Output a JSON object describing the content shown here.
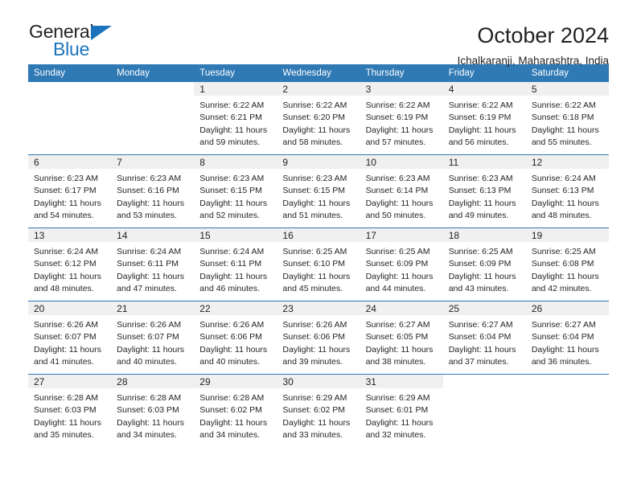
{
  "brand": {
    "name_top": "General",
    "name_bottom": "Blue",
    "accent_color": "#1b74bb"
  },
  "header": {
    "title": "October 2024",
    "subtitle": "Ichalkaranji, Maharashtra, India"
  },
  "calendar": {
    "header_color": "#2f79b5",
    "daynum_bg": "#f0f0f0",
    "weekday_labels": [
      "Sunday",
      "Monday",
      "Tuesday",
      "Wednesday",
      "Thursday",
      "Friday",
      "Saturday"
    ],
    "weeks": [
      [
        {
          "day": "",
          "blank": true
        },
        {
          "day": "",
          "blank": true
        },
        {
          "day": "1",
          "sunrise": "Sunrise: 6:22 AM",
          "sunset": "Sunset: 6:21 PM",
          "daylight1": "Daylight: 11 hours",
          "daylight2": "and 59 minutes."
        },
        {
          "day": "2",
          "sunrise": "Sunrise: 6:22 AM",
          "sunset": "Sunset: 6:20 PM",
          "daylight1": "Daylight: 11 hours",
          "daylight2": "and 58 minutes."
        },
        {
          "day": "3",
          "sunrise": "Sunrise: 6:22 AM",
          "sunset": "Sunset: 6:19 PM",
          "daylight1": "Daylight: 11 hours",
          "daylight2": "and 57 minutes."
        },
        {
          "day": "4",
          "sunrise": "Sunrise: 6:22 AM",
          "sunset": "Sunset: 6:19 PM",
          "daylight1": "Daylight: 11 hours",
          "daylight2": "and 56 minutes."
        },
        {
          "day": "5",
          "sunrise": "Sunrise: 6:22 AM",
          "sunset": "Sunset: 6:18 PM",
          "daylight1": "Daylight: 11 hours",
          "daylight2": "and 55 minutes."
        }
      ],
      [
        {
          "day": "6",
          "sunrise": "Sunrise: 6:23 AM",
          "sunset": "Sunset: 6:17 PM",
          "daylight1": "Daylight: 11 hours",
          "daylight2": "and 54 minutes."
        },
        {
          "day": "7",
          "sunrise": "Sunrise: 6:23 AM",
          "sunset": "Sunset: 6:16 PM",
          "daylight1": "Daylight: 11 hours",
          "daylight2": "and 53 minutes."
        },
        {
          "day": "8",
          "sunrise": "Sunrise: 6:23 AM",
          "sunset": "Sunset: 6:15 PM",
          "daylight1": "Daylight: 11 hours",
          "daylight2": "and 52 minutes."
        },
        {
          "day": "9",
          "sunrise": "Sunrise: 6:23 AM",
          "sunset": "Sunset: 6:15 PM",
          "daylight1": "Daylight: 11 hours",
          "daylight2": "and 51 minutes."
        },
        {
          "day": "10",
          "sunrise": "Sunrise: 6:23 AM",
          "sunset": "Sunset: 6:14 PM",
          "daylight1": "Daylight: 11 hours",
          "daylight2": "and 50 minutes."
        },
        {
          "day": "11",
          "sunrise": "Sunrise: 6:23 AM",
          "sunset": "Sunset: 6:13 PM",
          "daylight1": "Daylight: 11 hours",
          "daylight2": "and 49 minutes."
        },
        {
          "day": "12",
          "sunrise": "Sunrise: 6:24 AM",
          "sunset": "Sunset: 6:13 PM",
          "daylight1": "Daylight: 11 hours",
          "daylight2": "and 48 minutes."
        }
      ],
      [
        {
          "day": "13",
          "sunrise": "Sunrise: 6:24 AM",
          "sunset": "Sunset: 6:12 PM",
          "daylight1": "Daylight: 11 hours",
          "daylight2": "and 48 minutes."
        },
        {
          "day": "14",
          "sunrise": "Sunrise: 6:24 AM",
          "sunset": "Sunset: 6:11 PM",
          "daylight1": "Daylight: 11 hours",
          "daylight2": "and 47 minutes."
        },
        {
          "day": "15",
          "sunrise": "Sunrise: 6:24 AM",
          "sunset": "Sunset: 6:11 PM",
          "daylight1": "Daylight: 11 hours",
          "daylight2": "and 46 minutes."
        },
        {
          "day": "16",
          "sunrise": "Sunrise: 6:25 AM",
          "sunset": "Sunset: 6:10 PM",
          "daylight1": "Daylight: 11 hours",
          "daylight2": "and 45 minutes."
        },
        {
          "day": "17",
          "sunrise": "Sunrise: 6:25 AM",
          "sunset": "Sunset: 6:09 PM",
          "daylight1": "Daylight: 11 hours",
          "daylight2": "and 44 minutes."
        },
        {
          "day": "18",
          "sunrise": "Sunrise: 6:25 AM",
          "sunset": "Sunset: 6:09 PM",
          "daylight1": "Daylight: 11 hours",
          "daylight2": "and 43 minutes."
        },
        {
          "day": "19",
          "sunrise": "Sunrise: 6:25 AM",
          "sunset": "Sunset: 6:08 PM",
          "daylight1": "Daylight: 11 hours",
          "daylight2": "and 42 minutes."
        }
      ],
      [
        {
          "day": "20",
          "sunrise": "Sunrise: 6:26 AM",
          "sunset": "Sunset: 6:07 PM",
          "daylight1": "Daylight: 11 hours",
          "daylight2": "and 41 minutes."
        },
        {
          "day": "21",
          "sunrise": "Sunrise: 6:26 AM",
          "sunset": "Sunset: 6:07 PM",
          "daylight1": "Daylight: 11 hours",
          "daylight2": "and 40 minutes."
        },
        {
          "day": "22",
          "sunrise": "Sunrise: 6:26 AM",
          "sunset": "Sunset: 6:06 PM",
          "daylight1": "Daylight: 11 hours",
          "daylight2": "and 40 minutes."
        },
        {
          "day": "23",
          "sunrise": "Sunrise: 6:26 AM",
          "sunset": "Sunset: 6:06 PM",
          "daylight1": "Daylight: 11 hours",
          "daylight2": "and 39 minutes."
        },
        {
          "day": "24",
          "sunrise": "Sunrise: 6:27 AM",
          "sunset": "Sunset: 6:05 PM",
          "daylight1": "Daylight: 11 hours",
          "daylight2": "and 38 minutes."
        },
        {
          "day": "25",
          "sunrise": "Sunrise: 6:27 AM",
          "sunset": "Sunset: 6:04 PM",
          "daylight1": "Daylight: 11 hours",
          "daylight2": "and 37 minutes."
        },
        {
          "day": "26",
          "sunrise": "Sunrise: 6:27 AM",
          "sunset": "Sunset: 6:04 PM",
          "daylight1": "Daylight: 11 hours",
          "daylight2": "and 36 minutes."
        }
      ],
      [
        {
          "day": "27",
          "sunrise": "Sunrise: 6:28 AM",
          "sunset": "Sunset: 6:03 PM",
          "daylight1": "Daylight: 11 hours",
          "daylight2": "and 35 minutes."
        },
        {
          "day": "28",
          "sunrise": "Sunrise: 6:28 AM",
          "sunset": "Sunset: 6:03 PM",
          "daylight1": "Daylight: 11 hours",
          "daylight2": "and 34 minutes."
        },
        {
          "day": "29",
          "sunrise": "Sunrise: 6:28 AM",
          "sunset": "Sunset: 6:02 PM",
          "daylight1": "Daylight: 11 hours",
          "daylight2": "and 34 minutes."
        },
        {
          "day": "30",
          "sunrise": "Sunrise: 6:29 AM",
          "sunset": "Sunset: 6:02 PM",
          "daylight1": "Daylight: 11 hours",
          "daylight2": "and 33 minutes."
        },
        {
          "day": "31",
          "sunrise": "Sunrise: 6:29 AM",
          "sunset": "Sunset: 6:01 PM",
          "daylight1": "Daylight: 11 hours",
          "daylight2": "and 32 minutes."
        },
        {
          "day": "",
          "blank": true
        },
        {
          "day": "",
          "blank": true
        }
      ]
    ]
  }
}
